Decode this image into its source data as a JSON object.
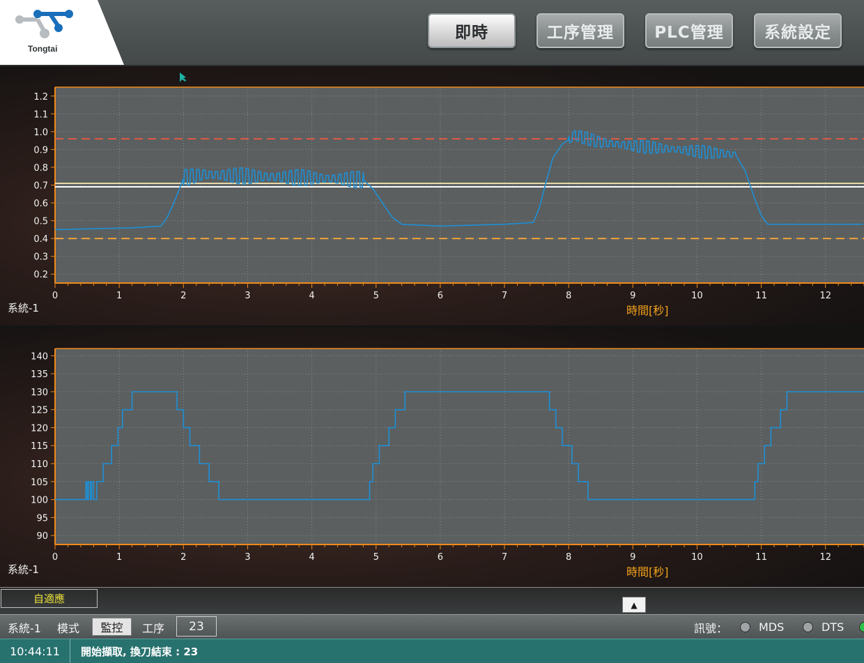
{
  "header": {
    "logo_text": "Tongtai",
    "tabs": [
      {
        "label": "即時",
        "active": true
      },
      {
        "label": "工序管理",
        "active": false
      },
      {
        "label": "PLC管理",
        "active": false
      },
      {
        "label": "系統設定",
        "active": false
      }
    ]
  },
  "chart_data": [
    {
      "type": "line",
      "system_label": "系統-1",
      "xlabel": "時間[秒]",
      "xlim": [
        0,
        12.6
      ],
      "ylim": [
        0.15,
        1.25
      ],
      "x_ticks": [
        0,
        1,
        2,
        3,
        4,
        5,
        6,
        7,
        8,
        9,
        10,
        11,
        12
      ],
      "y_ticks": [
        0.2,
        0.3,
        0.4,
        0.5,
        0.6,
        0.7,
        0.8,
        0.9,
        1.0,
        1.1,
        1.2
      ],
      "y_tick_labels": [
        "0.2",
        "0.3",
        "0.4",
        "0.5",
        "0.6",
        "0.7",
        "0.8",
        "0.9",
        "1.0",
        "1.1",
        "1.2"
      ],
      "grid": true,
      "reference_lines": [
        {
          "y": 0.96,
          "style": "dashed",
          "color": "#e05a43"
        },
        {
          "y": 0.71,
          "style": "solid",
          "color": "#e6d9a8"
        },
        {
          "y": 0.69,
          "style": "solid",
          "color": "#ffffff"
        },
        {
          "y": 0.4,
          "style": "dashed",
          "color": "#f0a13a"
        }
      ],
      "series": [
        {
          "color": "#1e90d6",
          "x": [
            0,
            1.2,
            1.65,
            1.75,
            1.85,
            1.95,
            2.0,
            2.3,
            3.0,
            4.0,
            4.8,
            4.95,
            5.1,
            5.25,
            5.4,
            6.0,
            7.0,
            7.45,
            7.55,
            7.65,
            7.75,
            7.9,
            8.1,
            8.5,
            9.0,
            10.0,
            10.6,
            10.75,
            10.9,
            11.0,
            11.1,
            11.6,
            12.6
          ],
          "y": [
            0.45,
            0.46,
            0.47,
            0.52,
            0.6,
            0.69,
            0.74,
            0.76,
            0.75,
            0.74,
            0.73,
            0.68,
            0.6,
            0.52,
            0.48,
            0.47,
            0.48,
            0.49,
            0.58,
            0.72,
            0.85,
            0.93,
            0.98,
            0.94,
            0.92,
            0.89,
            0.87,
            0.78,
            0.62,
            0.53,
            0.48,
            0.48,
            0.48
          ],
          "ripple": [
            {
              "from": 2.0,
              "to": 4.8,
              "amplitude": 0.045
            },
            {
              "from": 8.0,
              "to": 10.6,
              "amplitude": 0.035
            }
          ]
        }
      ]
    },
    {
      "type": "line",
      "step": true,
      "system_label": "系統-1",
      "xlabel": "時間[秒]",
      "xlim": [
        0,
        12.6
      ],
      "ylim": [
        87.5,
        142
      ],
      "x_ticks": [
        0,
        1,
        2,
        3,
        4,
        5,
        6,
        7,
        8,
        9,
        10,
        11,
        12
      ],
      "y_ticks": [
        90,
        95,
        100,
        105,
        110,
        115,
        120,
        125,
        130,
        135,
        140
      ],
      "y_tick_labels": [
        "90",
        "95",
        "100",
        "105",
        "110",
        "115",
        "120",
        "125",
        "130",
        "135",
        "140"
      ],
      "grid": true,
      "series": [
        {
          "color": "#1e90d6",
          "x": [
            0,
            0.48,
            0.5,
            0.52,
            0.55,
            0.57,
            0.6,
            0.65,
            0.75,
            0.88,
            0.98,
            1.05,
            1.2,
            1.9,
            2.0,
            2.1,
            2.25,
            2.4,
            2.55,
            4.9,
            4.95,
            5.05,
            5.2,
            5.3,
            5.45,
            5.55,
            7.7,
            7.8,
            7.9,
            8.05,
            8.15,
            8.3,
            10.9,
            10.95,
            11.05,
            11.15,
            11.3,
            11.4,
            11.5,
            12.6
          ],
          "y": [
            100,
            105,
            100,
            105,
            100,
            105,
            100,
            105,
            110,
            115,
            120,
            125,
            130,
            125,
            120,
            115,
            110,
            105,
            100,
            105,
            110,
            115,
            120,
            125,
            130,
            130,
            125,
            120,
            115,
            110,
            105,
            100,
            105,
            110,
            115,
            120,
            125,
            130,
            130,
            130
          ]
        }
      ]
    }
  ],
  "strip": {
    "adaptive_label": "自適應",
    "expand_icon": "▲"
  },
  "status": {
    "system": "系統-1",
    "mode_label": "模式",
    "mode_value": "監控",
    "step_label": "工序",
    "step_value": "23",
    "signal_label": "訊號：",
    "indicators": [
      {
        "label": "MDS",
        "color": "#9fa3a5"
      },
      {
        "label": "DTS",
        "color": "#9fa3a5"
      },
      {
        "label": "",
        "color": "#2cc24a"
      }
    ]
  },
  "message": {
    "time": "10:44:11",
    "text": "開始擷取, 換刀結束 : 23"
  }
}
